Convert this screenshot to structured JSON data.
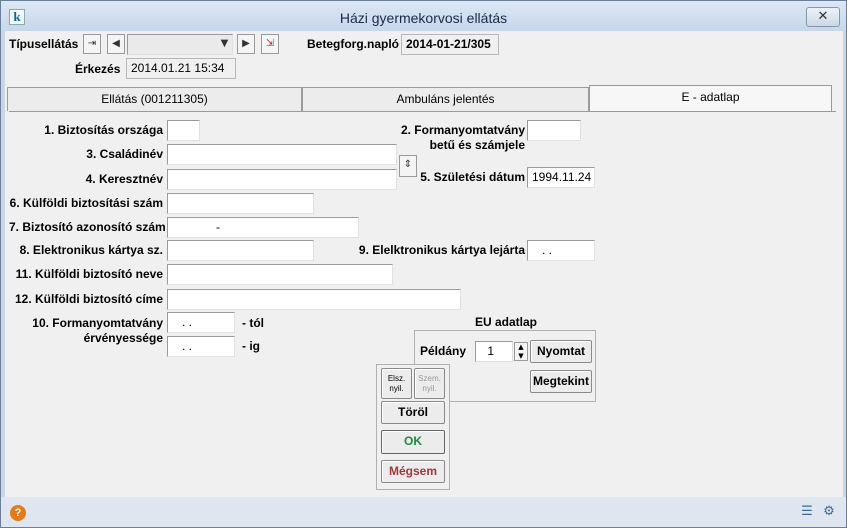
{
  "window": {
    "title": "Házi gyermekorvosi ellátás",
    "close_icon": "✕"
  },
  "header": {
    "tipusellatas_label": "Típusellátás",
    "tipusellatas_value": "",
    "erkezes_label": "Érkezés",
    "erkezes_value": "2014.01.21 15:34",
    "betegforg_label": "Betegforg.napló",
    "betegforg_value": "2014-01-21/305"
  },
  "tabs": [
    {
      "label": "Ellátás (001211305)"
    },
    {
      "label": "Ambuláns jelentés"
    },
    {
      "label": "E - adatlap"
    }
  ],
  "form": {
    "f1_label": "1. Biztosítás országa",
    "f1_value": "",
    "f2_label_line1": "2. Formanyomtatvány",
    "f2_label_line2": "betű és számjele",
    "f2_value": "",
    "f3_label": "3. Családinév",
    "f3_value": "",
    "f4_label": "4. Keresztnév",
    "f4_value": "",
    "f5_label": "5. Születési dátum",
    "f5_value": "1994.11.24",
    "f6_label": "6. Külföldi biztosítási szám",
    "f6_value": "",
    "f7_label": "7. Biztosító azonosító szám",
    "f7_value": "-",
    "f8_label": "8. Elektronikus kártya sz.",
    "f8_value": "",
    "f9_label": "9. Elelktronikus kártya lejárta",
    "f9_value": ". .",
    "f11_label": "11. Külföldi biztosító neve",
    "f11_value": "",
    "f12_label": "12. Külföldi biztosító címe",
    "f12_value": "",
    "f10_label_line1": "10. Formanyomtatvány",
    "f10_label_line2": "érvényessége",
    "f10_from_value": ". .",
    "f10_from_suffix": "- tól",
    "f10_to_value": ". .",
    "f10_to_suffix": "- ig"
  },
  "eu": {
    "title": "EU adatlap",
    "peldany_label": "Példány",
    "peldany_value": "1",
    "nyomtat_label": "Nyomtat",
    "megtekint_label": "Megtekint"
  },
  "actions": {
    "elsz_line1": "Elsz.",
    "elsz_line2": "nyil.",
    "szem_line1": "Szem.",
    "szem_line2": "nyil.",
    "torol_label": "Töröl",
    "ok_label": "OK",
    "megsem_label": "Mégsem"
  },
  "colors": {
    "ok_green": "#1f8a3a",
    "cancel_red": "#a23838",
    "help_orange": "#e57a1a"
  }
}
